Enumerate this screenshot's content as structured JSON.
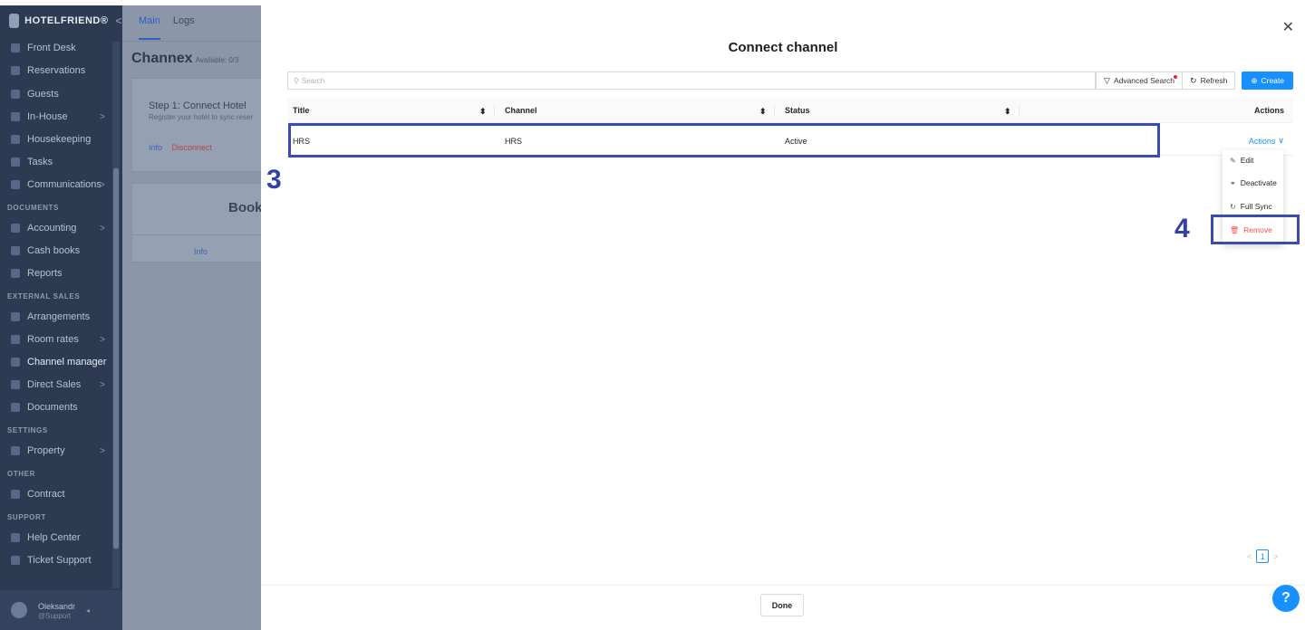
{
  "sidebar": {
    "brand": "HOTELFRIEND",
    "items": [
      {
        "label": "Front Desk"
      },
      {
        "label": "Reservations"
      },
      {
        "label": "Guests"
      },
      {
        "label": "In-House"
      },
      {
        "label": "Housekeeping"
      },
      {
        "label": "Tasks"
      },
      {
        "label": "Communications"
      },
      {
        "label": "Accounting"
      },
      {
        "label": "Cash books"
      },
      {
        "label": "Reports"
      },
      {
        "label": "Arrangements"
      },
      {
        "label": "Room rates"
      },
      {
        "label": "Channel manager"
      },
      {
        "label": "Direct Sales"
      },
      {
        "label": "Documents"
      },
      {
        "label": "Property"
      },
      {
        "label": "Contract"
      },
      {
        "label": "Help Center"
      },
      {
        "label": "Ticket Support"
      }
    ],
    "sections": {
      "documents": "DOCUMENTS",
      "external_sales": "EXTERNAL SALES",
      "settings": "SETTINGS",
      "other": "OTHER",
      "support": "SUPPORT"
    },
    "user": {
      "name": "Oleksandr",
      "role": "@Support"
    }
  },
  "background_page": {
    "tabs": {
      "main": "Main",
      "logs": "Logs"
    },
    "title": "Channex",
    "available": "Available: 0/3",
    "card": {
      "heading": "Step 1: Connect Hotel",
      "description": "Register your hotel to sync reser",
      "info": "Info",
      "disconnect": "Disconnect"
    },
    "card2": {
      "heading_partial": "Book",
      "info": "Info"
    }
  },
  "modal": {
    "title": "Connect channel",
    "search_placeholder": "Search",
    "advanced_search": "Advanced Search",
    "refresh": "Refresh",
    "create": "Create",
    "columns": {
      "title": "Title",
      "channel": "Channel",
      "status": "Status",
      "actions": "Actions"
    },
    "rows": [
      {
        "title": "HRS",
        "channel": "HRS",
        "status": "Active",
        "actions": "Actions"
      }
    ],
    "dropdown": {
      "edit": "Edit",
      "deactivate": "Deactivate",
      "full_sync": "Full Sync",
      "remove": "Remove"
    },
    "pagination": {
      "current_page": "1"
    },
    "done": "Done"
  },
  "annotations": {
    "step3": "3",
    "step4": "4"
  },
  "help_label": "?",
  "colors": {
    "primary": "#1890ff",
    "annotation": "#3b4bb0",
    "danger": "#ff4d4f",
    "sidebar_overlay": "#2c3a52"
  }
}
